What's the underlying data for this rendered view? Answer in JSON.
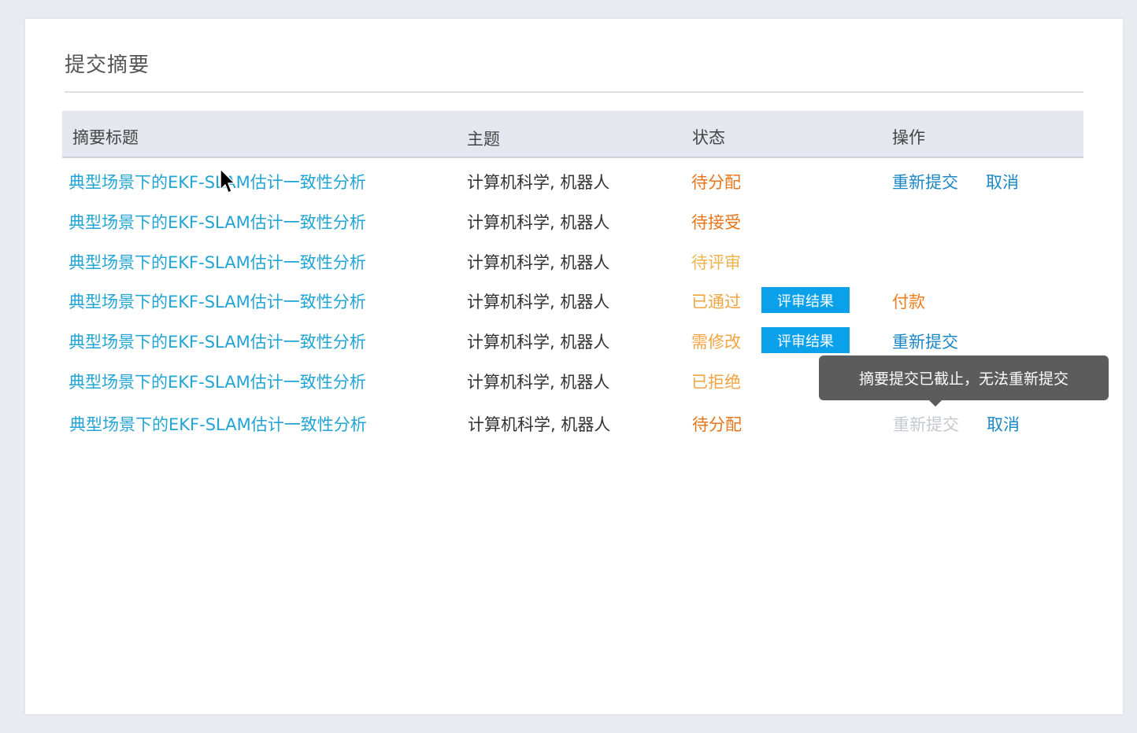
{
  "page": {
    "title": "提交摘要"
  },
  "table": {
    "headers": {
      "title": "摘要标题",
      "topic": "主题",
      "status": "状态",
      "actions": "操作"
    },
    "rows": [
      {
        "title": "典型场景下的EKF-SLAM估计一致性分析",
        "topic": "计算机科学, 机器人",
        "status": "待分配",
        "status_color": "#e8751a",
        "result_button": "",
        "action1": "重新提交",
        "action2": "取消"
      },
      {
        "title": "典型场景下的EKF-SLAM估计一致性分析",
        "topic": "计算机科学, 机器人",
        "status": "待接受",
        "status_color": "#e8751a",
        "result_button": "",
        "action1": "",
        "action2": ""
      },
      {
        "title": "典型场景下的EKF-SLAM估计一致性分析",
        "topic": "计算机科学, 机器人",
        "status": "待评审",
        "status_color": "#f2b24f",
        "result_button": "",
        "action1": "",
        "action2": ""
      },
      {
        "title": "典型场景下的EKF-SLAM估计一致性分析",
        "topic": "计算机科学, 机器人",
        "status": "已通过",
        "status_color": "#f2a441",
        "result_button": "评审结果",
        "action1": "付款",
        "action2": ""
      },
      {
        "title": "典型场景下的EKF-SLAM估计一致性分析",
        "topic": "计算机科学, 机器人",
        "status": "需修改",
        "status_color": "#f2a441",
        "result_button": "评审结果",
        "action1": "重新提交",
        "action2": ""
      },
      {
        "title": "典型场景下的EKF-SLAM估计一致性分析",
        "topic": "计算机科学, 机器人",
        "status": "已拒绝",
        "status_color": "#f2a441",
        "result_button": "",
        "action1": "",
        "action2": ""
      },
      {
        "title": "典型场景下的EKF-SLAM估计一致性分析",
        "topic": "计算机科学, 机器人",
        "status": "待分配",
        "status_color": "#e8751a",
        "result_button": "",
        "action1": "重新提交",
        "action2": "取消"
      }
    ]
  },
  "tooltip": {
    "text": "摘要提交已截止，无法重新提交"
  },
  "colors": {
    "link": "#22a4d4",
    "action": "#1a87c5",
    "pay": "#ee7d1c",
    "disabled": "#c5c8ce",
    "button": "#0aa0ea"
  }
}
